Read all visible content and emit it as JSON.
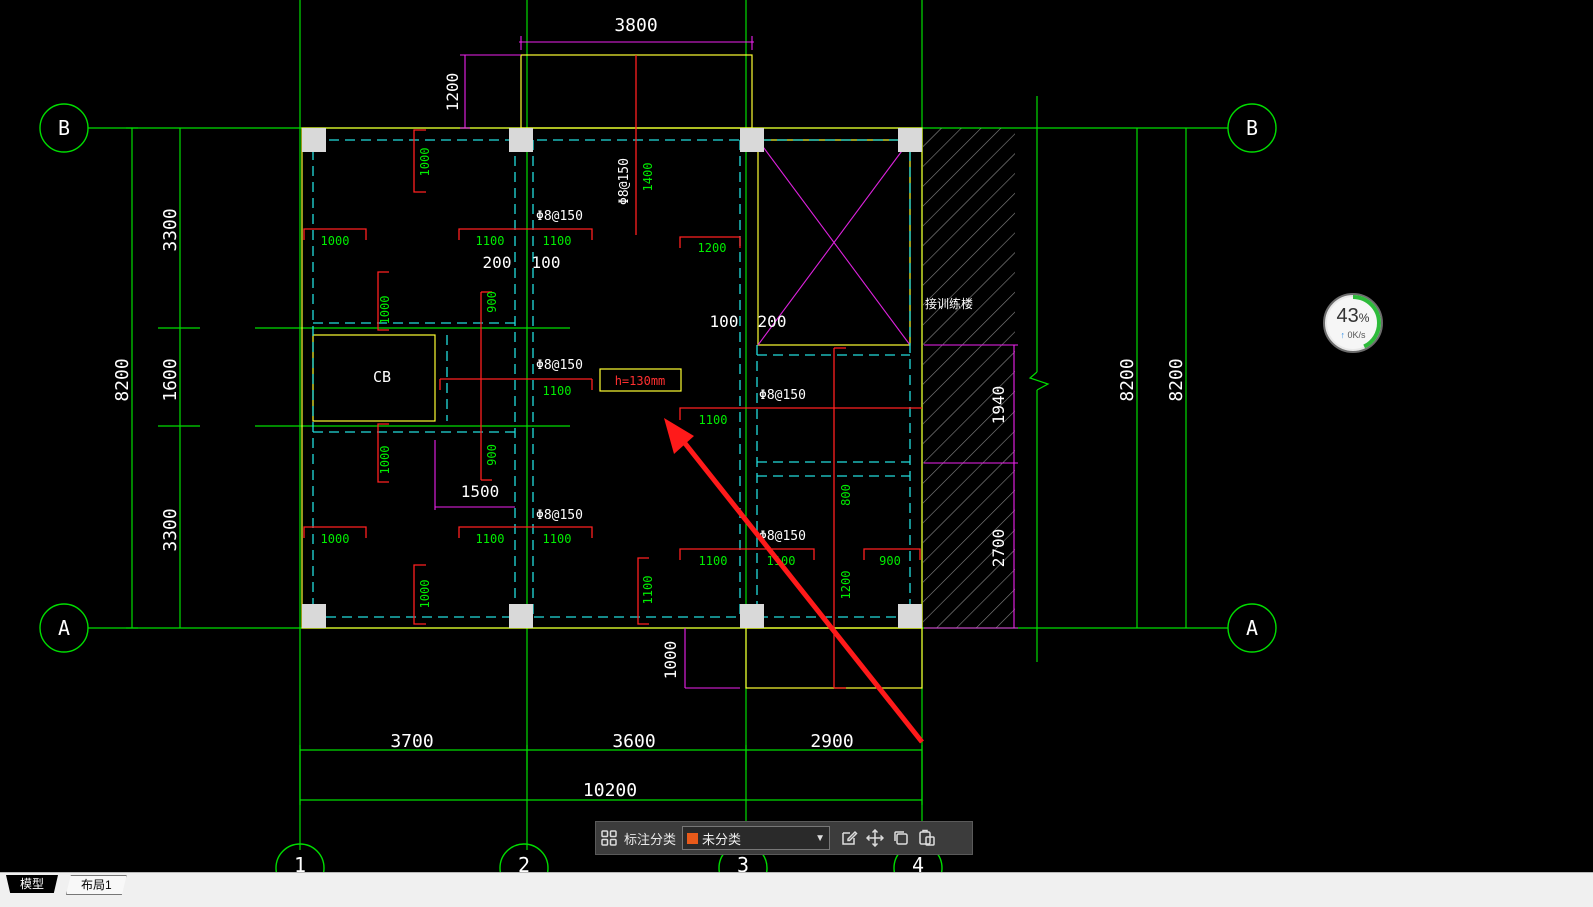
{
  "drawing": {
    "grid_bubbles": {
      "row_b": "B",
      "row_a": "A",
      "col_1": "1",
      "col_2": "2",
      "col_3": "3",
      "col_4": "4"
    },
    "dimensions": {
      "top_opening_width": "3800",
      "top_opening_depth": "1200",
      "left_span_top": "3300",
      "left_span_mid": "1600",
      "left_span_bottom": "3300",
      "left_total": "8200",
      "right_total_inner": "8200",
      "right_total_outer": "8200",
      "bay_1": "3700",
      "bay_2": "3600",
      "bay_3": "2900",
      "overall_width": "10200",
      "gap_200_left": "200",
      "gap_100_left": "100",
      "gap_100_right": "100",
      "gap_200_right": "200",
      "opening_1500": "1500",
      "stair_1940": "1940",
      "stair_2700": "2700",
      "bottom_ext_1000": "1000"
    },
    "rebar_labels": {
      "r1": "Φ8@150",
      "r2": "Φ8@150",
      "r3": "Φ8@150",
      "r4": "Φ8@150",
      "r5": "Φ8@150",
      "r6": "Φ8@150"
    },
    "green_lengths": {
      "g1000a": "1000",
      "g1000b": "1000",
      "g1000c": "1000",
      "g1000d": "1000",
      "g1000e": "1000",
      "g1000f": "1000",
      "g1100a": "1100",
      "g1100b": "1100",
      "g1100c": "1100",
      "g1100d": "1100",
      "g1100e": "1100",
      "g1100f": "1100",
      "g1100g": "1100",
      "g1100h": "1100",
      "g1100i": "1100",
      "g1100j": "1100",
      "g1200a": "1200",
      "g1200b": "1200",
      "g1400": "1400",
      "g900a": "900",
      "g900b": "900",
      "g900c": "900",
      "g800": "800"
    },
    "slab_thickness": "h=130mm",
    "column_beam_label": "CB",
    "stair_note": "接训练楼"
  },
  "speed_widget": {
    "percent": "43",
    "percent_unit": "%",
    "rate": "0K/s"
  },
  "toolbar": {
    "category_label": "标注分类",
    "selected_category": "未分类"
  },
  "tabs": {
    "model": "模型",
    "layout1": "布局1"
  },
  "colors": {
    "grid_green": "#00dd00",
    "wall_yellow": "#ffff33",
    "rebar_red": "#ff2020",
    "dim_magenta": "#ee22ee",
    "hidden_cyan": "#22dddd",
    "arrow_red": "#ff1a1a"
  }
}
